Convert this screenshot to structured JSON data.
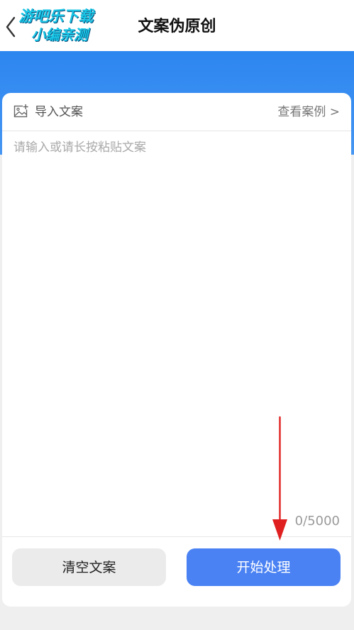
{
  "header": {
    "title": "文案伪原创",
    "back_icon": "chevron-left-icon",
    "watermark": {
      "line1": "游吧乐下载",
      "line2": "小编亲测"
    }
  },
  "editor": {
    "import_label": "导入文案",
    "import_icon": "image-add-icon",
    "example_link": "查看案例 >",
    "placeholder": "请输入或请长按粘贴文案",
    "value": "",
    "counter": "0/5000"
  },
  "actions": {
    "clear_label": "清空文案",
    "start_label": "开始处理"
  },
  "colors": {
    "accent_blue": "#4a82f3",
    "header_band": "#2c86f0",
    "annotation_arrow": "#e02020"
  }
}
